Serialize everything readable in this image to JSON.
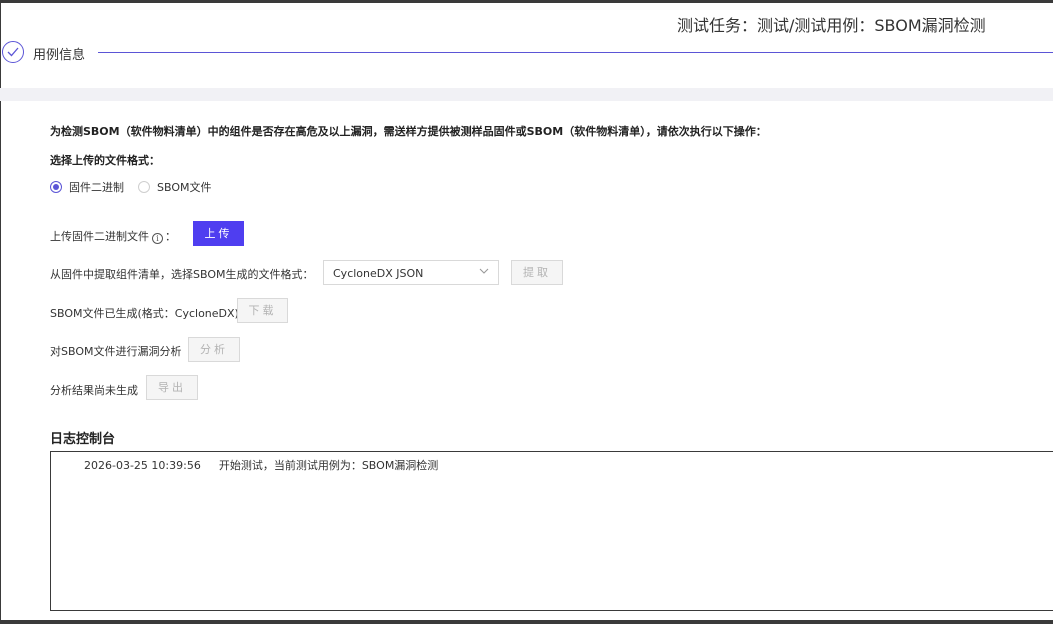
{
  "header": {
    "title": "测试任务：测试/测试用例：SBOM漏洞检测"
  },
  "steps": {
    "current_label": "用例信息"
  },
  "instruction": "为检测SBOM（软件物料清单）中的组件是否存在高危及以上漏洞，需送样方提供被测样品固件或SBOM（软件物料清单），请依次执行以下操作：",
  "format_select": {
    "label": "选择上传的文件格式：",
    "options": [
      {
        "label": "固件二进制",
        "checked": true
      },
      {
        "label": "SBOM文件",
        "checked": false
      }
    ]
  },
  "upload": {
    "label": "上传固件二进制文件",
    "info_icon": "info-icon",
    "colon": "：",
    "button": "上传"
  },
  "extract": {
    "label": "从固件中提取组件清单，选择SBOM生成的文件格式：",
    "selected_format": "CycloneDX JSON",
    "button": "提取"
  },
  "download": {
    "label": "SBOM文件已生成(格式：CycloneDX)",
    "button": "下载"
  },
  "analyze": {
    "label": "对SBOM文件进行漏洞分析",
    "button": "分析"
  },
  "export": {
    "label": "分析结果尚未生成",
    "button": "导出"
  },
  "console": {
    "title": "日志控制台",
    "logs": [
      {
        "time": "2026-03-25 10:39:56",
        "message": "开始测试，当前测试用例为：SBOM漏洞检测"
      }
    ]
  },
  "colors": {
    "accent": "#4f3ef0",
    "step_accent": "#5b55d6",
    "disabled_bg": "#f5f5f5",
    "band_bg": "#f1f1f5"
  }
}
